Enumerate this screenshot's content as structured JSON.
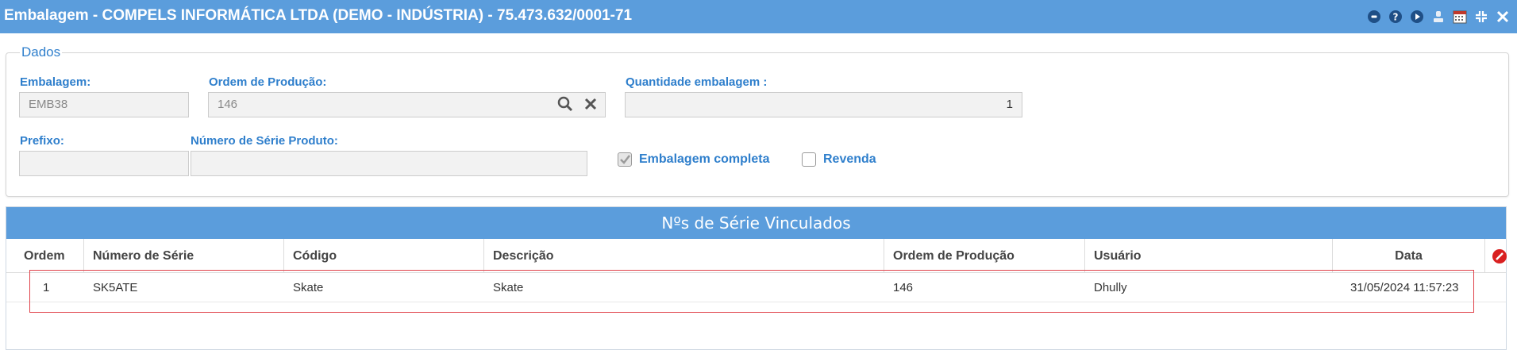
{
  "window": {
    "title": "Embalagem - COMPELS INFORMÁTICA LTDA (DEMO - INDÚSTRIA) - 75.473.632/0001-71",
    "icons": [
      "record-icon",
      "help-icon",
      "play-icon",
      "user-icon",
      "calendar-icon",
      "collapse-icon",
      "close-icon"
    ]
  },
  "form": {
    "legend": "Dados",
    "embalagem_label": "Embalagem:",
    "embalagem_value": "EMB38",
    "ordem_label": "Ordem de Produção:",
    "ordem_value": "146",
    "quantidade_label": "Quantidade embalagem :",
    "quantidade_value": "1",
    "prefixo_label": "Prefixo:",
    "prefixo_value": "",
    "numero_serie_label": "Número de Série Produto:",
    "numero_serie_value": "",
    "embalagem_completa_label": "Embalagem completa",
    "embalagem_completa_checked": true,
    "revenda_label": "Revenda",
    "revenda_checked": false
  },
  "grid": {
    "title": "Nºs de Série Vinculados",
    "columns": [
      "Ordem",
      "Número de Série",
      "Código",
      "Descrição",
      "Ordem de Produção",
      "Usuário",
      "Data"
    ],
    "rows": [
      {
        "ordem": "1",
        "numero_serie": "SK5ATE",
        "codigo": "Skate",
        "descricao": "Skate",
        "ordem_producao": "146",
        "usuario": "Dhully",
        "data": "31/05/2024 11:57:23"
      }
    ]
  },
  "colors": {
    "header_blue": "#5b9ddc",
    "label_blue": "#2f7fcc",
    "highlight_red": "#e0424a"
  }
}
